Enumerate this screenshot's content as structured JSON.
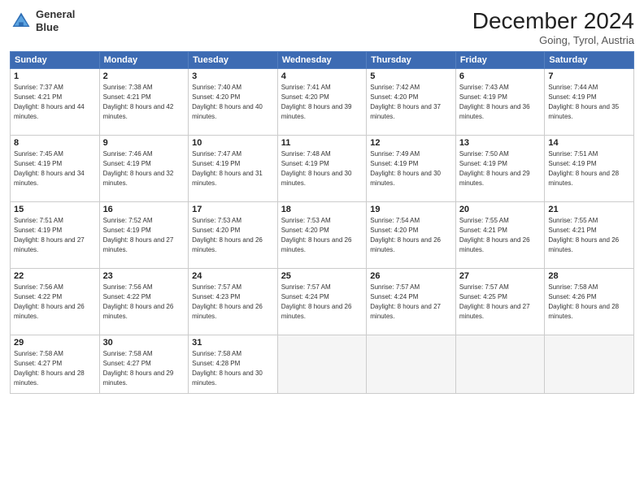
{
  "header": {
    "logo_line1": "General",
    "logo_line2": "Blue",
    "month": "December 2024",
    "location": "Going, Tyrol, Austria"
  },
  "weekdays": [
    "Sunday",
    "Monday",
    "Tuesday",
    "Wednesday",
    "Thursday",
    "Friday",
    "Saturday"
  ],
  "weeks": [
    [
      {
        "day": "1",
        "sunrise": "Sunrise: 7:37 AM",
        "sunset": "Sunset: 4:21 PM",
        "daylight": "Daylight: 8 hours and 44 minutes."
      },
      {
        "day": "2",
        "sunrise": "Sunrise: 7:38 AM",
        "sunset": "Sunset: 4:21 PM",
        "daylight": "Daylight: 8 hours and 42 minutes."
      },
      {
        "day": "3",
        "sunrise": "Sunrise: 7:40 AM",
        "sunset": "Sunset: 4:20 PM",
        "daylight": "Daylight: 8 hours and 40 minutes."
      },
      {
        "day": "4",
        "sunrise": "Sunrise: 7:41 AM",
        "sunset": "Sunset: 4:20 PM",
        "daylight": "Daylight: 8 hours and 39 minutes."
      },
      {
        "day": "5",
        "sunrise": "Sunrise: 7:42 AM",
        "sunset": "Sunset: 4:20 PM",
        "daylight": "Daylight: 8 hours and 37 minutes."
      },
      {
        "day": "6",
        "sunrise": "Sunrise: 7:43 AM",
        "sunset": "Sunset: 4:19 PM",
        "daylight": "Daylight: 8 hours and 36 minutes."
      },
      {
        "day": "7",
        "sunrise": "Sunrise: 7:44 AM",
        "sunset": "Sunset: 4:19 PM",
        "daylight": "Daylight: 8 hours and 35 minutes."
      }
    ],
    [
      {
        "day": "8",
        "sunrise": "Sunrise: 7:45 AM",
        "sunset": "Sunset: 4:19 PM",
        "daylight": "Daylight: 8 hours and 34 minutes."
      },
      {
        "day": "9",
        "sunrise": "Sunrise: 7:46 AM",
        "sunset": "Sunset: 4:19 PM",
        "daylight": "Daylight: 8 hours and 32 minutes."
      },
      {
        "day": "10",
        "sunrise": "Sunrise: 7:47 AM",
        "sunset": "Sunset: 4:19 PM",
        "daylight": "Daylight: 8 hours and 31 minutes."
      },
      {
        "day": "11",
        "sunrise": "Sunrise: 7:48 AM",
        "sunset": "Sunset: 4:19 PM",
        "daylight": "Daylight: 8 hours and 30 minutes."
      },
      {
        "day": "12",
        "sunrise": "Sunrise: 7:49 AM",
        "sunset": "Sunset: 4:19 PM",
        "daylight": "Daylight: 8 hours and 30 minutes."
      },
      {
        "day": "13",
        "sunrise": "Sunrise: 7:50 AM",
        "sunset": "Sunset: 4:19 PM",
        "daylight": "Daylight: 8 hours and 29 minutes."
      },
      {
        "day": "14",
        "sunrise": "Sunrise: 7:51 AM",
        "sunset": "Sunset: 4:19 PM",
        "daylight": "Daylight: 8 hours and 28 minutes."
      }
    ],
    [
      {
        "day": "15",
        "sunrise": "Sunrise: 7:51 AM",
        "sunset": "Sunset: 4:19 PM",
        "daylight": "Daylight: 8 hours and 27 minutes."
      },
      {
        "day": "16",
        "sunrise": "Sunrise: 7:52 AM",
        "sunset": "Sunset: 4:19 PM",
        "daylight": "Daylight: 8 hours and 27 minutes."
      },
      {
        "day": "17",
        "sunrise": "Sunrise: 7:53 AM",
        "sunset": "Sunset: 4:20 PM",
        "daylight": "Daylight: 8 hours and 26 minutes."
      },
      {
        "day": "18",
        "sunrise": "Sunrise: 7:53 AM",
        "sunset": "Sunset: 4:20 PM",
        "daylight": "Daylight: 8 hours and 26 minutes."
      },
      {
        "day": "19",
        "sunrise": "Sunrise: 7:54 AM",
        "sunset": "Sunset: 4:20 PM",
        "daylight": "Daylight: 8 hours and 26 minutes."
      },
      {
        "day": "20",
        "sunrise": "Sunrise: 7:55 AM",
        "sunset": "Sunset: 4:21 PM",
        "daylight": "Daylight: 8 hours and 26 minutes."
      },
      {
        "day": "21",
        "sunrise": "Sunrise: 7:55 AM",
        "sunset": "Sunset: 4:21 PM",
        "daylight": "Daylight: 8 hours and 26 minutes."
      }
    ],
    [
      {
        "day": "22",
        "sunrise": "Sunrise: 7:56 AM",
        "sunset": "Sunset: 4:22 PM",
        "daylight": "Daylight: 8 hours and 26 minutes."
      },
      {
        "day": "23",
        "sunrise": "Sunrise: 7:56 AM",
        "sunset": "Sunset: 4:22 PM",
        "daylight": "Daylight: 8 hours and 26 minutes."
      },
      {
        "day": "24",
        "sunrise": "Sunrise: 7:57 AM",
        "sunset": "Sunset: 4:23 PM",
        "daylight": "Daylight: 8 hours and 26 minutes."
      },
      {
        "day": "25",
        "sunrise": "Sunrise: 7:57 AM",
        "sunset": "Sunset: 4:24 PM",
        "daylight": "Daylight: 8 hours and 26 minutes."
      },
      {
        "day": "26",
        "sunrise": "Sunrise: 7:57 AM",
        "sunset": "Sunset: 4:24 PM",
        "daylight": "Daylight: 8 hours and 27 minutes."
      },
      {
        "day": "27",
        "sunrise": "Sunrise: 7:57 AM",
        "sunset": "Sunset: 4:25 PM",
        "daylight": "Daylight: 8 hours and 27 minutes."
      },
      {
        "day": "28",
        "sunrise": "Sunrise: 7:58 AM",
        "sunset": "Sunset: 4:26 PM",
        "daylight": "Daylight: 8 hours and 28 minutes."
      }
    ],
    [
      {
        "day": "29",
        "sunrise": "Sunrise: 7:58 AM",
        "sunset": "Sunset: 4:27 PM",
        "daylight": "Daylight: 8 hours and 28 minutes."
      },
      {
        "day": "30",
        "sunrise": "Sunrise: 7:58 AM",
        "sunset": "Sunset: 4:27 PM",
        "daylight": "Daylight: 8 hours and 29 minutes."
      },
      {
        "day": "31",
        "sunrise": "Sunrise: 7:58 AM",
        "sunset": "Sunset: 4:28 PM",
        "daylight": "Daylight: 8 hours and 30 minutes."
      },
      null,
      null,
      null,
      null
    ]
  ]
}
